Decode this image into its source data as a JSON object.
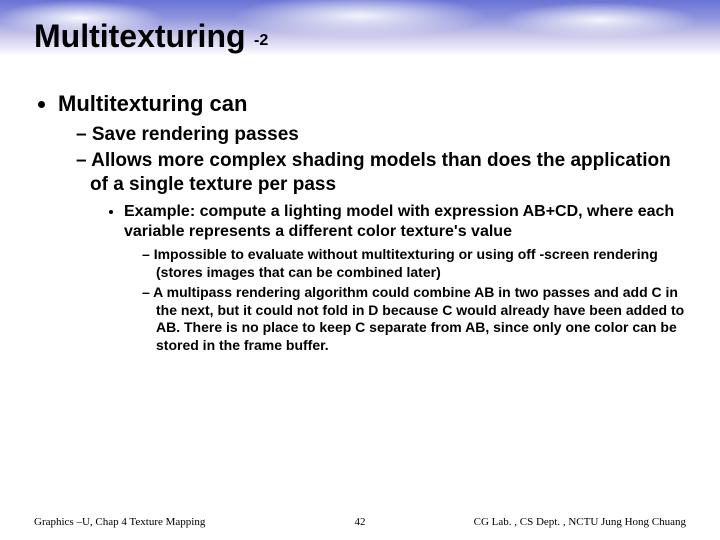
{
  "title": {
    "main": "Multitexturing",
    "suffix": "-2"
  },
  "bullets": {
    "l1": "Multitexturing can",
    "l2a": "Save rendering passes",
    "l2b": "Allows more complex shading models than does the application of a single texture per pass",
    "l3a": "Example: compute a lighting model with expression AB+CD, where each variable represents a different color texture's value",
    "l4a": "Impossible to evaluate without multitexturing or using off -screen rendering (stores images that can be combined later)",
    "l4b": "A multipass rendering algorithm could combine AB in two passes and add C in the next, but it could not fold in D because C would already have been added to AB. There is no place to keep C separate from AB, since only one color can be stored in the frame buffer."
  },
  "footer": {
    "left": "Graphics –U, Chap 4   Texture Mapping",
    "page": "42",
    "right": "CG Lab. , CS Dept. , NCTU  Jung Hong Chuang"
  }
}
